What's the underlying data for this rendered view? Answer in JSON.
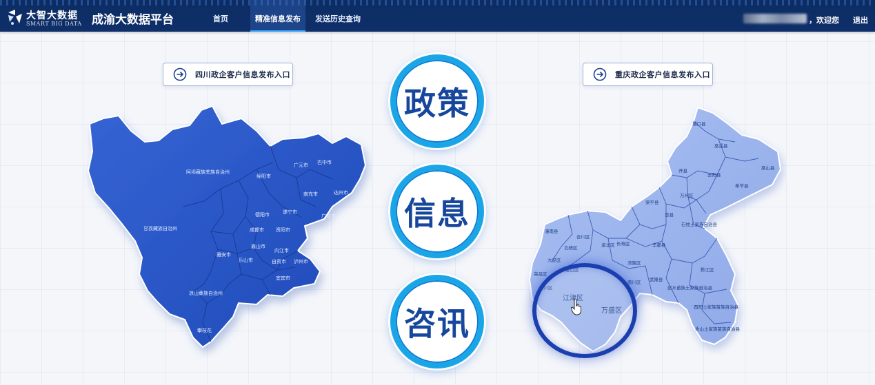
{
  "header": {
    "logo_cn": "大智大数据",
    "logo_en": "SMART BIG DATA",
    "platform_title": "成渝大数据平台",
    "nav": [
      {
        "label": "首页",
        "active": false
      },
      {
        "label": "精准信息发布",
        "active": true
      },
      {
        "label": "发送历史查询",
        "active": false
      }
    ],
    "welcome": "，欢迎您",
    "logout": "退出"
  },
  "entries": {
    "sichuan": "四川政企客户信息发布入口",
    "chongqing": "重庆政企客户信息发布入口"
  },
  "slogan": {
    "word1": "政策",
    "word2": "信息",
    "word3": "咨讯"
  },
  "sichuan_map": {
    "labels": [
      "阿坝藏族羌族自治州",
      "广元市",
      "巴中市",
      "绵阳市",
      "南充市",
      "达州市",
      "德阳市",
      "遂宁市",
      "广安市",
      "成都市",
      "眉山市",
      "资阳市",
      "内江市",
      "甘孜藏族自治州",
      "雅安市",
      "乐山市",
      "自贡市",
      "泸州市",
      "宜宾市",
      "凉山彝族自治州",
      "攀枝花"
    ]
  },
  "chongqing_map": {
    "labels": [
      "城口县",
      "巫溪县",
      "巫山县",
      "奉节县",
      "云阳县",
      "开县",
      "万州区",
      "梁平县",
      "忠县",
      "潼南县",
      "合川区",
      "北碚区",
      "渝北区",
      "长寿区",
      "涪陵区",
      "丰都县",
      "石柱土家族自治县",
      "大足区",
      "荣昌区",
      "永川区",
      "璧山区",
      "江津区",
      "万盛区",
      "南川区",
      "武隆县",
      "彭水苗族土家族自治县",
      "黔江区",
      "酉阳土家族苗族自治县",
      "秀山土家族苗族自治县"
    ],
    "highlight": [
      "江津区",
      "万盛区"
    ]
  },
  "colors": {
    "header_bg": "#0f2f6a",
    "sichuan_fill": "#2a56c6",
    "chongqing_fill": "#9db6ef",
    "ring": "#1aa6e6",
    "slogan_text": "#16479c"
  }
}
